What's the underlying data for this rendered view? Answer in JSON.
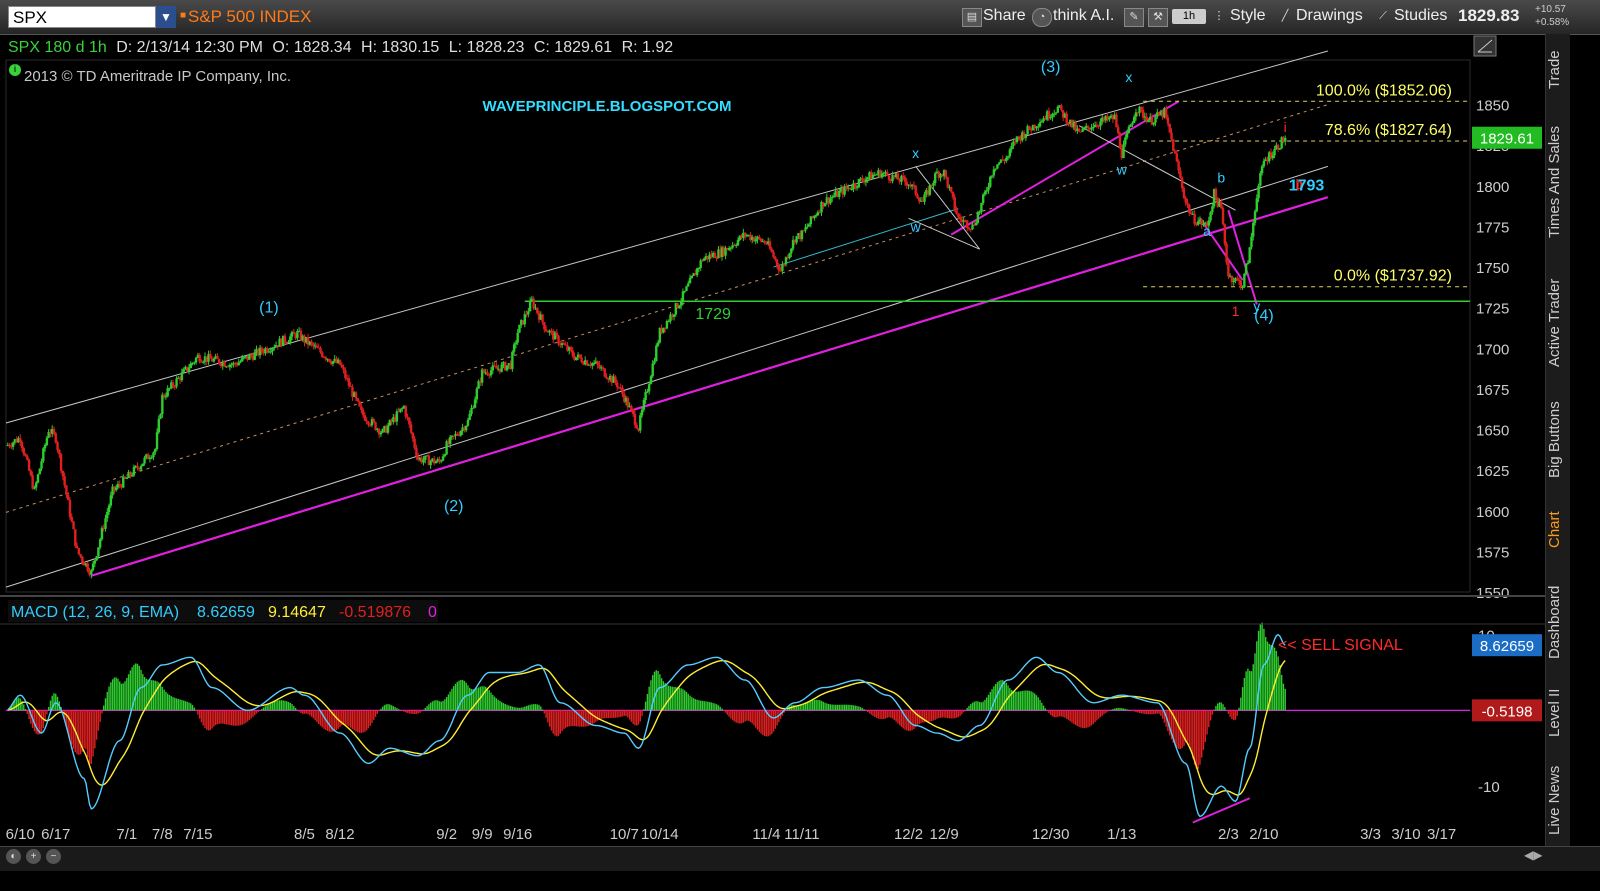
{
  "toolbar": {
    "symbol": "SPX",
    "index_name": "S&P 500 INDEX",
    "share": "Share",
    "think_ai": "think A.I.",
    "timeframe": "1h",
    "style": "Style",
    "drawings": "Drawings",
    "studies": "Studies",
    "last_price": "1829.83",
    "change_abs": "+10.57",
    "change_pct": "+0.58%"
  },
  "info_bar": {
    "symbol": "SPX 180 d 1h",
    "date": "D: 2/13/14 12:30 PM",
    "open": "O: 1828.34",
    "high": "H: 1830.15",
    "low": "L: 1828.23",
    "close": "C: 1829.61",
    "range": "R: 1.92"
  },
  "copyright": "2013 © TD Ameritrade IP Company, Inc.",
  "sidebar_tabs": [
    "Trade",
    "Times And Sales",
    "Active Trader",
    "Big Buttons",
    "Chart",
    "Dashboard",
    "Level II",
    "Live News"
  ],
  "colors": {
    "background": "#000000",
    "up_candle": "#2ecc2e",
    "down_candle": "#e02020",
    "channel": "#c8c8c8",
    "trendline": "#e020e0",
    "support": "#33cc33",
    "fib": "#ffff66",
    "wave_label": "#33ccff",
    "macd_line": "#55ccff",
    "signal_line": "#ffee33",
    "sell_signal": "#ff2a2a"
  },
  "chart_data": [
    {
      "type": "candlestick",
      "instrument": "SPX",
      "interval": "1h",
      "title": "",
      "ylim": [
        1550,
        1875
      ],
      "y_ticks": [
        1550,
        1575,
        1600,
        1625,
        1650,
        1675,
        1700,
        1725,
        1750,
        1775,
        1800,
        1825,
        1850
      ],
      "x_ticks": [
        "6/10",
        "6/17",
        "7/1",
        "7/8",
        "7/15",
        "8/5",
        "8/12",
        "9/2",
        "9/9",
        "9/16",
        "10/7",
        "10/14",
        "11/4",
        "11/11",
        "12/2",
        "12/9",
        "12/30",
        "1/13",
        "2/3",
        "2/10",
        "3/3",
        "3/10",
        "3/17"
      ],
      "price_path": [
        {
          "date": "6/6",
          "price": 1640
        },
        {
          "date": "6/10",
          "price": 1645
        },
        {
          "date": "6/12",
          "price": 1612
        },
        {
          "date": "6/14",
          "price": 1650
        },
        {
          "date": "6/17",
          "price": 1645
        },
        {
          "date": "6/20",
          "price": 1575
        },
        {
          "date": "6/24",
          "price": 1562
        },
        {
          "date": "6/27",
          "price": 1612
        },
        {
          "date": "7/1",
          "price": 1620
        },
        {
          "date": "7/5",
          "price": 1638
        },
        {
          "date": "7/8",
          "price": 1670
        },
        {
          "date": "7/12",
          "price": 1690
        },
        {
          "date": "7/15",
          "price": 1695
        },
        {
          "date": "7/22",
          "price": 1690
        },
        {
          "date": "8/2",
          "price": 1709
        },
        {
          "date": "8/5",
          "price": 1705
        },
        {
          "date": "8/9",
          "price": 1692
        },
        {
          "date": "8/12",
          "price": 1690
        },
        {
          "date": "8/15",
          "price": 1660
        },
        {
          "date": "8/20",
          "price": 1648
        },
        {
          "date": "8/23",
          "price": 1664
        },
        {
          "date": "8/27",
          "price": 1632
        },
        {
          "date": "8/30",
          "price": 1630
        },
        {
          "date": "9/2",
          "price": 1640
        },
        {
          "date": "9/5",
          "price": 1655
        },
        {
          "date": "9/9",
          "price": 1685
        },
        {
          "date": "9/13",
          "price": 1690
        },
        {
          "date": "9/16",
          "price": 1710
        },
        {
          "date": "9/18",
          "price": 1729
        },
        {
          "date": "9/20",
          "price": 1712
        },
        {
          "date": "9/26",
          "price": 1695
        },
        {
          "date": "10/1",
          "price": 1690
        },
        {
          "date": "10/4",
          "price": 1678
        },
        {
          "date": "10/7",
          "price": 1670
        },
        {
          "date": "10/9",
          "price": 1651
        },
        {
          "date": "10/11",
          "price": 1690
        },
        {
          "date": "10/14",
          "price": 1710
        },
        {
          "date": "10/17",
          "price": 1730
        },
        {
          "date": "10/22",
          "price": 1755
        },
        {
          "date": "10/25",
          "price": 1760
        },
        {
          "date": "10/30",
          "price": 1770
        },
        {
          "date": "11/4",
          "price": 1765
        },
        {
          "date": "11/6",
          "price": 1748
        },
        {
          "date": "11/8",
          "price": 1768
        },
        {
          "date": "11/11",
          "price": 1770
        },
        {
          "date": "11/14",
          "price": 1790
        },
        {
          "date": "11/18",
          "price": 1795
        },
        {
          "date": "11/22",
          "price": 1805
        },
        {
          "date": "11/26",
          "price": 1808
        },
        {
          "date": "12/2",
          "price": 1802
        },
        {
          "date": "12/4",
          "price": 1790
        },
        {
          "date": "12/6",
          "price": 1808
        },
        {
          "date": "12/9",
          "price": 1808
        },
        {
          "date": "12/11",
          "price": 1780
        },
        {
          "date": "12/13",
          "price": 1775
        },
        {
          "date": "12/16",
          "price": 1785
        },
        {
          "date": "12/18",
          "price": 1812
        },
        {
          "date": "12/20",
          "price": 1818
        },
        {
          "date": "12/23",
          "price": 1828
        },
        {
          "date": "12/27",
          "price": 1842
        },
        {
          "date": "12/31",
          "price": 1848
        },
        {
          "date": "1/3",
          "price": 1832
        },
        {
          "date": "1/7",
          "price": 1838
        },
        {
          "date": "1/10",
          "price": 1842
        },
        {
          "date": "1/13",
          "price": 1820
        },
        {
          "date": "1/15",
          "price": 1848
        },
        {
          "date": "1/17",
          "price": 1840
        },
        {
          "date": "1/21",
          "price": 1845
        },
        {
          "date": "1/22",
          "price": 1828
        },
        {
          "date": "1/24",
          "price": 1790
        },
        {
          "date": "1/27",
          "price": 1780
        },
        {
          "date": "1/29",
          "price": 1775
        },
        {
          "date": "1/30",
          "price": 1795
        },
        {
          "date": "1/31",
          "price": 1785
        },
        {
          "date": "2/3",
          "price": 1745
        },
        {
          "date": "2/5",
          "price": 1739
        },
        {
          "date": "2/6",
          "price": 1760
        },
        {
          "date": "2/7",
          "price": 1795
        },
        {
          "date": "2/10",
          "price": 1815
        },
        {
          "date": "2/11",
          "price": 1820
        },
        {
          "date": "2/13",
          "price": 1829.61
        }
      ],
      "horizontal_levels": [
        {
          "label": "1729",
          "value": 1729,
          "color": "#33cc33"
        }
      ],
      "fib_levels": [
        {
          "label": "100.0%  ($1852.06)",
          "value": 1852.06
        },
        {
          "label": "78.6%  ($1827.64)",
          "value": 1827.64
        },
        {
          "label": "0.0%  ($1737.92)",
          "value": 1737.92
        }
      ],
      "wave_labels": [
        {
          "text": "(1)",
          "date": "7/29",
          "price": 1722,
          "color": "#33ccff"
        },
        {
          "text": "(2)",
          "date": "9/3",
          "price": 1600,
          "color": "#33ccff"
        },
        {
          "text": "(3)",
          "date": "12/30",
          "price": 1870,
          "color": "#33ccff"
        },
        {
          "text": "(4)",
          "date": "2/9",
          "price": 1717,
          "color": "#33ccff"
        },
        {
          "text": "x",
          "date": "12/3",
          "price": 1817,
          "color": "#33ccff"
        },
        {
          "text": "w",
          "date": "12/3",
          "price": 1772,
          "color": "#33ccff"
        },
        {
          "text": "x",
          "date": "1/14",
          "price": 1864,
          "color": "#33ccff"
        },
        {
          "text": "w",
          "date": "1/13",
          "price": 1807,
          "color": "#33ccff"
        },
        {
          "text": "b",
          "date": "1/31",
          "price": 1802,
          "color": "#33ccff"
        },
        {
          "text": "a",
          "date": "1/29",
          "price": 1769,
          "color": "#33ccff"
        },
        {
          "text": "y",
          "date": "2/7",
          "price": 1723,
          "color": "#33ccff"
        },
        {
          "text": "1",
          "date": "2/4",
          "price": 1720,
          "color": "#ff2a2a"
        },
        {
          "text": "i",
          "date": "2/13",
          "price": 1833,
          "color": "#ff2a2a"
        },
        {
          "text": "ii",
          "date": "2/15",
          "price": 1797,
          "color": "#ff2a2a"
        },
        {
          "text": "b",
          "date": "2/16",
          "price": 1798,
          "color": "#ff2a2a"
        },
        {
          "text": "1793",
          "date": "2/18",
          "price": 1797,
          "color": "#33ccff"
        }
      ],
      "annotation": "WAVEPRINCIPLE.BLOGSPOT.COM",
      "last_value": "1829.61"
    },
    {
      "type": "line",
      "title": "MACD (12, 26, 9, EMA)",
      "series": [
        {
          "name": "Value",
          "display": "8.62659",
          "color": "#55ccff"
        },
        {
          "name": "Avg",
          "display": "9.14647",
          "color": "#ffee33"
        },
        {
          "name": "Diff",
          "display": "-0.519876",
          "color": "#e02020"
        },
        {
          "name": "ZeroLine",
          "display": "0",
          "color": "#e020e0"
        }
      ],
      "y_ticks": [
        "10",
        "-10"
      ],
      "ylim": [
        -15,
        11
      ],
      "last_value_tag": "8.62659",
      "diff_tag": "-0.5198",
      "annotation": "<< SELL SIGNAL",
      "macd_path": [
        {
          "date": "6/6",
          "value": 0
        },
        {
          "date": "6/10",
          "value": 2
        },
        {
          "date": "6/13",
          "value": -3
        },
        {
          "date": "6/17",
          "value": 1
        },
        {
          "date": "6/21",
          "value": -9
        },
        {
          "date": "6/24",
          "value": -13
        },
        {
          "date": "6/28",
          "value": -4
        },
        {
          "date": "7/3",
          "value": 3
        },
        {
          "date": "7/8",
          "value": 6
        },
        {
          "date": "7/12",
          "value": 7
        },
        {
          "date": "7/17",
          "value": 3
        },
        {
          "date": "7/24",
          "value": 0
        },
        {
          "date": "8/1",
          "value": 3
        },
        {
          "date": "8/5",
          "value": 2
        },
        {
          "date": "8/12",
          "value": -3
        },
        {
          "date": "8/16",
          "value": -7
        },
        {
          "date": "8/21",
          "value": -5
        },
        {
          "date": "8/27",
          "value": -6
        },
        {
          "date": "8/30",
          "value": -4
        },
        {
          "date": "9/5",
          "value": 2
        },
        {
          "date": "9/10",
          "value": 5
        },
        {
          "date": "9/16",
          "value": 5
        },
        {
          "date": "9/19",
          "value": 6
        },
        {
          "date": "9/24",
          "value": 1
        },
        {
          "date": "10/1",
          "value": -2
        },
        {
          "date": "10/7",
          "value": -3
        },
        {
          "date": "10/9",
          "value": -5
        },
        {
          "date": "10/14",
          "value": 3
        },
        {
          "date": "10/18",
          "value": 6
        },
        {
          "date": "10/24",
          "value": 7
        },
        {
          "date": "10/30",
          "value": 4
        },
        {
          "date": "11/5",
          "value": -1
        },
        {
          "date": "11/8",
          "value": 1
        },
        {
          "date": "11/14",
          "value": 3
        },
        {
          "date": "11/21",
          "value": 4
        },
        {
          "date": "11/27",
          "value": 2
        },
        {
          "date": "12/3",
          "value": -2
        },
        {
          "date": "12/6",
          "value": -3
        },
        {
          "date": "12/11",
          "value": -4
        },
        {
          "date": "12/16",
          "value": -2
        },
        {
          "date": "12/20",
          "value": 4
        },
        {
          "date": "12/26",
          "value": 7
        },
        {
          "date": "12/31",
          "value": 5
        },
        {
          "date": "1/7",
          "value": 1
        },
        {
          "date": "1/13",
          "value": 2
        },
        {
          "date": "1/20",
          "value": 1
        },
        {
          "date": "1/24",
          "value": -7
        },
        {
          "date": "1/28",
          "value": -14
        },
        {
          "date": "1/31",
          "value": -10
        },
        {
          "date": "2/4",
          "value": -12
        },
        {
          "date": "2/6",
          "value": -5
        },
        {
          "date": "2/10",
          "value": 6
        },
        {
          "date": "2/12",
          "value": 10
        },
        {
          "date": "2/13",
          "value": 8.6
        }
      ]
    }
  ]
}
